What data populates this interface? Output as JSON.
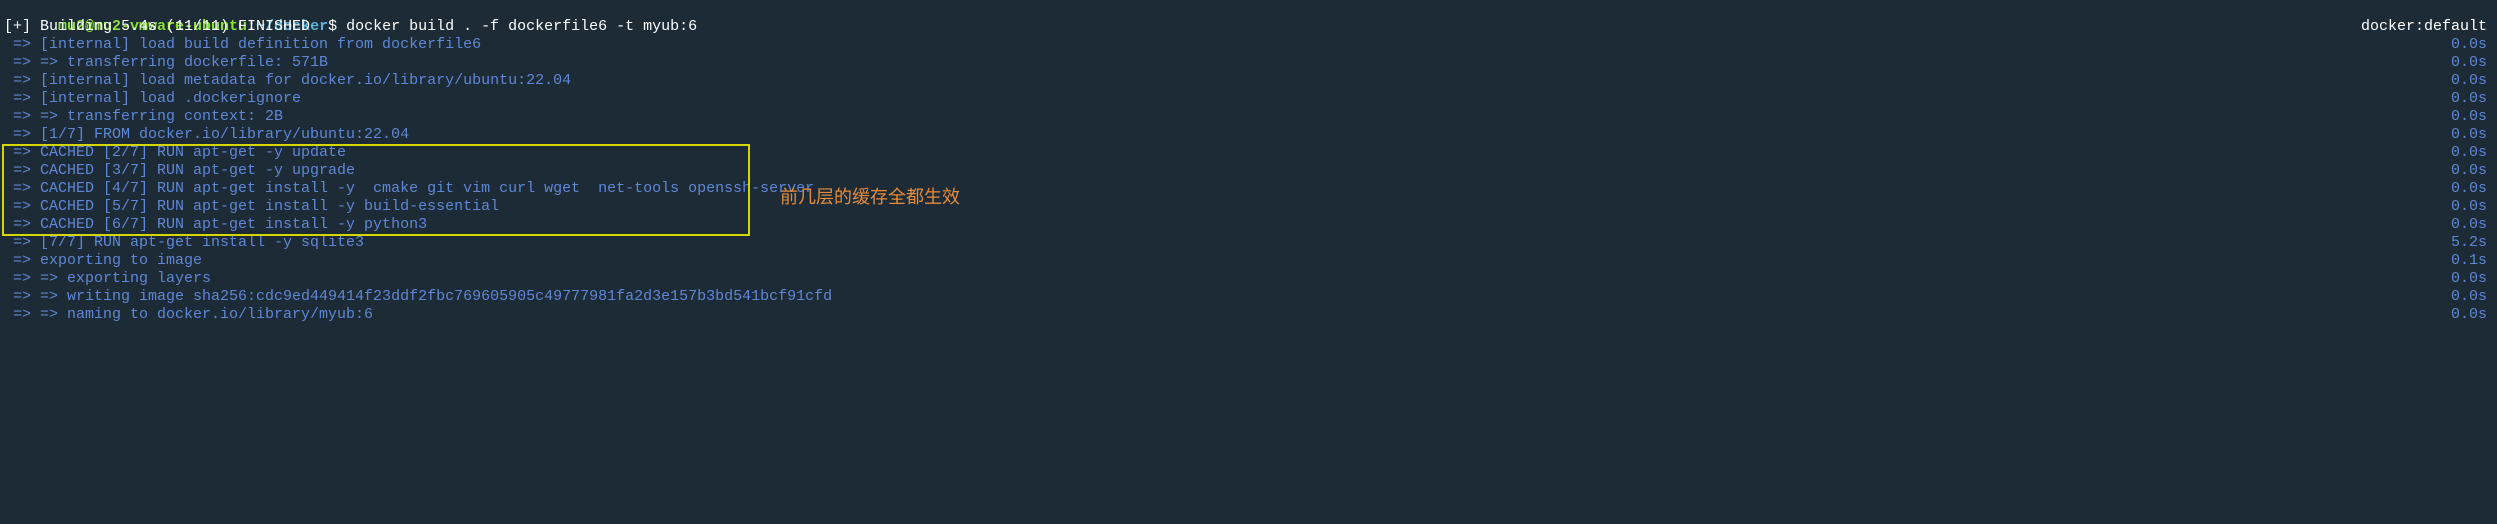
{
  "prompt": {
    "user_host": "mu2@mu2-vmware-ubuntu",
    "colon": ":",
    "path": "~/docker",
    "dollar": "$ ",
    "command": "docker build . -f dockerfile6 -t myub:6"
  },
  "header": {
    "left": "[+] Building 5.4s (11/11) FINISHED",
    "right": "docker:default"
  },
  "steps": [
    {
      "text": " => [internal] load build definition from dockerfile6",
      "time": "0.0s"
    },
    {
      "text": " => => transferring dockerfile: 571B",
      "time": "0.0s"
    },
    {
      "text": " => [internal] load metadata for docker.io/library/ubuntu:22.04",
      "time": "0.0s"
    },
    {
      "text": " => [internal] load .dockerignore",
      "time": "0.0s"
    },
    {
      "text": " => => transferring context: 2B",
      "time": "0.0s"
    },
    {
      "text": " => [1/7] FROM docker.io/library/ubuntu:22.04",
      "time": "0.0s"
    },
    {
      "text": " => CACHED [2/7] RUN apt-get -y update",
      "time": "0.0s"
    },
    {
      "text": " => CACHED [3/7] RUN apt-get -y upgrade",
      "time": "0.0s"
    },
    {
      "text": " => CACHED [4/7] RUN apt-get install -y  cmake git vim curl wget  net-tools openssh-server",
      "time": "0.0s"
    },
    {
      "text": " => CACHED [5/7] RUN apt-get install -y build-essential",
      "time": "0.0s"
    },
    {
      "text": " => CACHED [6/7] RUN apt-get install -y python3",
      "time": "0.0s"
    },
    {
      "text": " => [7/7] RUN apt-get install -y sqlite3",
      "time": "5.2s"
    },
    {
      "text": " => exporting to image",
      "time": "0.1s"
    },
    {
      "text": " => => exporting layers",
      "time": "0.0s"
    },
    {
      "text": " => => writing image sha256:cdc9ed449414f23ddf2fbc769605905c49777981fa2d3e157b3bd541bcf91cfd",
      "time": "0.0s"
    },
    {
      "text": " => => naming to docker.io/library/myub:6",
      "time": "0.0s"
    }
  ],
  "annotation": "前几层的缓存全都生效"
}
